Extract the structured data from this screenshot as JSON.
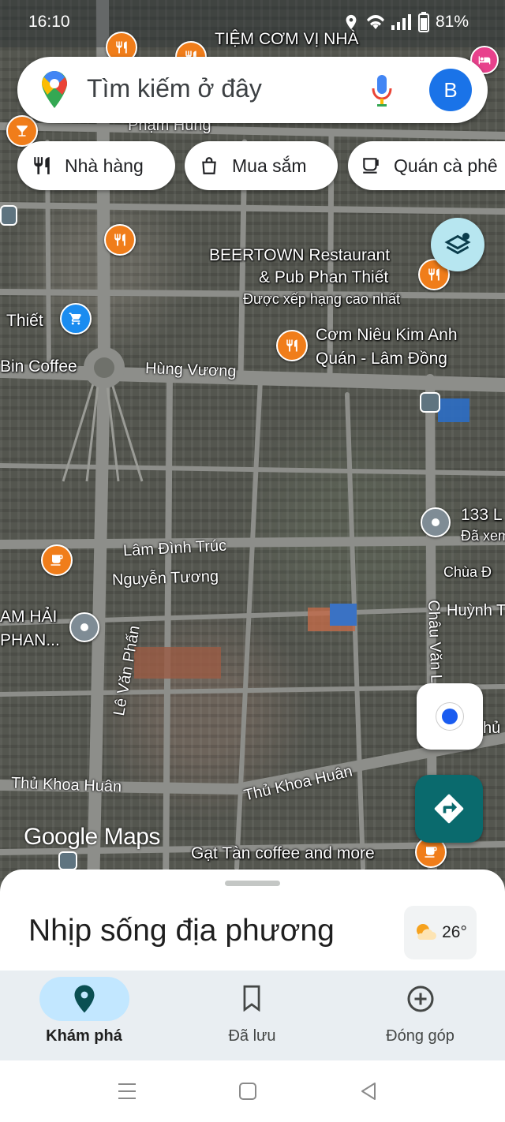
{
  "status_bar": {
    "time": "16:10",
    "battery": "81%"
  },
  "search": {
    "placeholder": "Tìm kiếm ở đây",
    "avatar_letter": "B"
  },
  "chips": [
    {
      "label": "Nhà hàng",
      "icon": "restaurant-icon"
    },
    {
      "label": "Mua sắm",
      "icon": "shopping-bag-icon"
    },
    {
      "label": "Quán cà phê",
      "icon": "coffee-icon"
    }
  ],
  "map": {
    "places": {
      "tiem_com": "TIỆM CƠM VỊ NHÀ",
      "pham_hung": "Phạm Hùng",
      "beertown_line1": "BEERTOWN Restaurant",
      "beertown_line2": "& Pub Phan Thiết",
      "beertown_note": "Được xếp hạng cao nhất",
      "com_nieu_line1": "Cơm Niêu Kim Anh",
      "com_nieu_line2": "Quán - Lâm Đồng",
      "thiet": "Thiết",
      "bin_coffee": "Bin Coffee",
      "addr_133": "133 L",
      "da_xem": "Đã xem",
      "chua_da": "Chùa Đ",
      "am_hai_line1": "AM HẢI",
      "am_hai_line2": "PHAN...",
      "gat_tan": "Gạt Tàn coffee and more",
      "google_maps": "Google Maps"
    },
    "roads": {
      "hung_vuong": "Hùng Vương",
      "lam_dinh_truc": "Lâm Đình Trúc",
      "nguyen_tuong": "Nguyễn Tương",
      "le_van_phan": "Lê Văn Phấn",
      "thu_khoa_huan_a": "Thủ Khoa Huân",
      "thu_khoa_huan_b": "Thủ Khoa Huân",
      "chau_van": "Châu Văn L",
      "huynh_t": "Huỳnh T",
      "thu_edge": "hủ"
    }
  },
  "sheet": {
    "title": "Nhịp sống địa phương",
    "temperature": "26°"
  },
  "bottom_nav": [
    {
      "label": "Khám phá",
      "active": true
    },
    {
      "label": "Đã lưu",
      "active": false
    },
    {
      "label": "Đóng góp",
      "active": false
    }
  ],
  "colors": {
    "accent_teal": "#0a6a6d",
    "nav_active_bg": "#c2e7ff",
    "pin_orange": "#f07d1a",
    "location_blue": "#1a5cf0"
  }
}
